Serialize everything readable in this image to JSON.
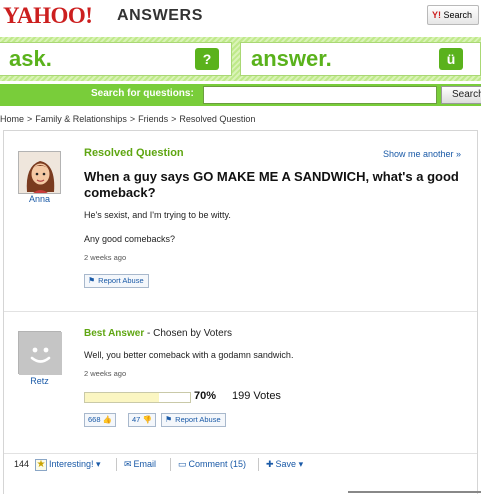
{
  "header": {
    "logo_text": "YAHOO!",
    "product_text": "ANSWERS",
    "yahoo_search_button": "Search",
    "yahoo_search_prefix": "Y!"
  },
  "band": {
    "ask_label": "ask.",
    "answer_label": "answer."
  },
  "search": {
    "label": "Search for questions:",
    "input_value": "",
    "button_label": "Search"
  },
  "breadcrumb": [
    "Home",
    "Family & Relationships",
    "Friends",
    "Resolved Question"
  ],
  "question": {
    "heading": "Resolved Question",
    "show_another": "Show me another »",
    "asker": "Anna",
    "title": "When a guy says GO MAKE ME A SANDWICH, what's a good comeback?",
    "detail_1": "He's sexist, and I'm trying to be witty.",
    "detail_2": "Any good comebacks?",
    "time": "2 weeks ago",
    "report_label": "Report Abuse"
  },
  "answer": {
    "best_label": "Best Answer",
    "chosen_by": " - Chosen by Voters",
    "answerer": "Retz",
    "text": "Well, you better comeback with a godamn sandwich.",
    "time": "2 weeks ago",
    "vote_percent_value": 70,
    "vote_percent": "70%",
    "vote_count": "199 Votes",
    "thumbs_up": "668",
    "thumbs_down": "47",
    "report_label": "Report Abuse"
  },
  "actions": {
    "star_count": "144",
    "interesting": "Interesting!",
    "email": "Email",
    "comment": "Comment (15)",
    "save": "Save"
  },
  "colors": {
    "brand_red": "#cc1f1f",
    "accent_green": "#5ab21c",
    "link_blue": "#1a5aa7"
  }
}
